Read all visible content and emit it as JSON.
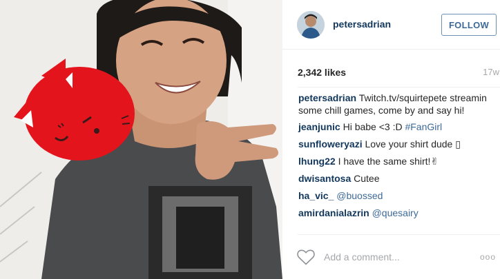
{
  "post": {
    "username": "petersadrian",
    "follow_label": "FOLLOW",
    "likes": "2,342 likes",
    "age": "17w",
    "caption": {
      "user": "petersadrian",
      "text": "Twitch.tv/squirtepete streamin some chill games, come by and say hi!"
    },
    "comments": [
      {
        "user": "jeanjunic",
        "text": "Hi babe <3 :D",
        "tag": "#FanGirl"
      },
      {
        "user": "sunfloweryazi",
        "text": "Love your shirt dude ▯",
        "tag": ""
      },
      {
        "user": "lhung22",
        "text": "I have the same shirt!✌",
        "tag": ""
      },
      {
        "user": "dwisantosa",
        "text": "Cutee",
        "tag": ""
      },
      {
        "user": "ha_vic_",
        "text": "",
        "tag": "@buossed"
      },
      {
        "user": "amirdanialazrin",
        "text": "",
        "tag": "@quesairy"
      }
    ],
    "add_comment_placeholder": "Add a comment...",
    "more_label": "ooo"
  },
  "icons": {
    "like": "heart-outline-icon",
    "more": "ellipsis-icon"
  },
  "colors": {
    "username": "#12375c",
    "link": "#3d6a99",
    "muted": "#a5a7aa",
    "follow_border": "#6d8fb2"
  }
}
